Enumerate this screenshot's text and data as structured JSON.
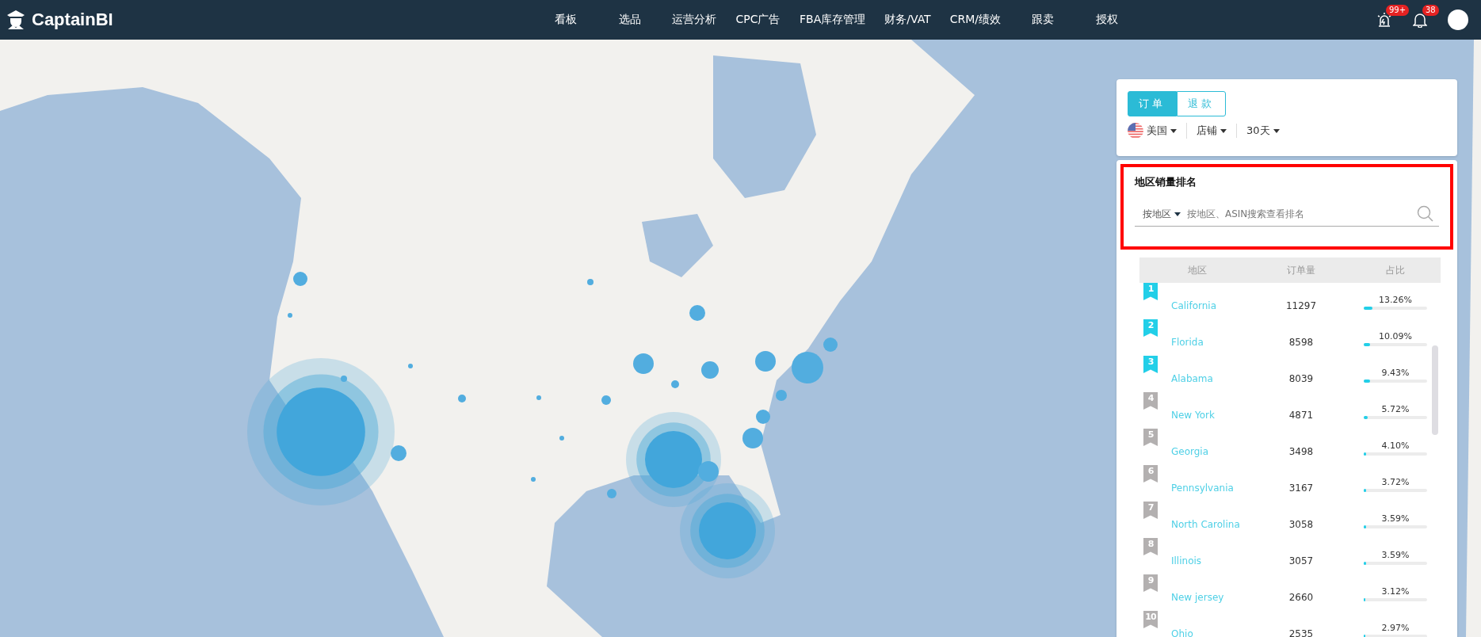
{
  "header": {
    "brand": "CaptainBI",
    "nav": [
      {
        "label": "看板",
        "selected": false
      },
      {
        "label": "选品",
        "selected": false
      },
      {
        "label": "运营分析",
        "selected": false
      },
      {
        "label": "CPC广告",
        "selected": false
      },
      {
        "label": "FBA库存管理",
        "selected": false
      },
      {
        "label": "财务/VAT",
        "selected": false
      },
      {
        "label": "CRM/绩效",
        "selected": false
      },
      {
        "label": "跟卖",
        "selected": false
      },
      {
        "label": "授权",
        "selected": false
      }
    ],
    "alerts_badge": "99+",
    "notifications_badge": "38"
  },
  "filter_card": {
    "tabs": [
      {
        "label": "订单",
        "selected": true
      },
      {
        "label": "退款",
        "selected": false
      }
    ],
    "dropdowns": [
      {
        "kind": "flag",
        "label": "美国"
      },
      {
        "kind": "plain",
        "label": "店铺"
      },
      {
        "kind": "plain",
        "label": "30天"
      }
    ]
  },
  "ranking": {
    "title": "地区销量排名",
    "search": {
      "scope": "按地区",
      "placeholder": "按地区、ASIN搜索查看排名"
    },
    "columns": [
      "地区",
      "订单量",
      "占比"
    ],
    "rows": [
      {
        "rank": "1",
        "top": true,
        "region": "California",
        "orders": "11297",
        "share": "13.26%",
        "level": 0.1326
      },
      {
        "rank": "2",
        "top": true,
        "region": "Florida",
        "orders": "8598",
        "share": "10.09%",
        "level": 0.1009
      },
      {
        "rank": "3",
        "top": true,
        "region": "Alabama",
        "orders": "8039",
        "share": "9.43%",
        "level": 0.0943
      },
      {
        "rank": "4",
        "top": false,
        "region": "New York",
        "orders": "4871",
        "share": "5.72%",
        "level": 0.0572
      },
      {
        "rank": "5",
        "top": false,
        "region": "Georgia",
        "orders": "3498",
        "share": "4.10%",
        "level": 0.041
      },
      {
        "rank": "6",
        "top": false,
        "region": "Pennsylvania",
        "orders": "3167",
        "share": "3.72%",
        "level": 0.0372
      },
      {
        "rank": "7",
        "top": false,
        "region": "North Carolina",
        "orders": "3058",
        "share": "3.59%",
        "level": 0.0359
      },
      {
        "rank": "8",
        "top": false,
        "region": "Illinois",
        "orders": "3057",
        "share": "3.59%",
        "level": 0.0359
      },
      {
        "rank": "9",
        "top": false,
        "region": "New jersey",
        "orders": "2660",
        "share": "3.12%",
        "level": 0.0312
      },
      {
        "rank": "10",
        "top": false,
        "region": "Ohio",
        "orders": "2535",
        "share": "2.97%",
        "level": 0.0297
      }
    ]
  }
}
